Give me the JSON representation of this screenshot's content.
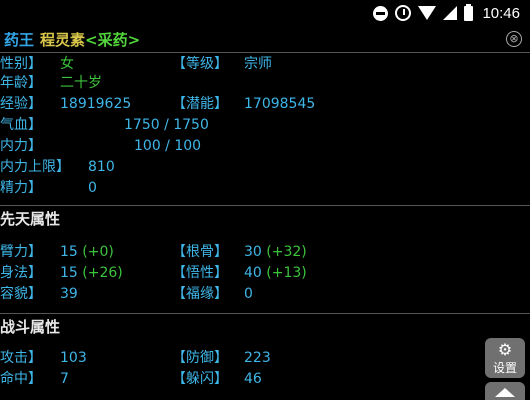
{
  "status_bar": {
    "time": "10:46",
    "icons": [
      "do-not-disturb-icon",
      "alarm-icon",
      "wifi-icon",
      "signal-icon",
      "battery-icon"
    ]
  },
  "title": {
    "rank": "药王",
    "name": "程灵素",
    "action": "<采药>",
    "close_icon": "⊗"
  },
  "basic": {
    "gender_label": "性别】",
    "gender_value": "女",
    "level_label": "【等级】",
    "level_value": "宗师",
    "age_label": "年龄】",
    "age_value": "二十岁",
    "exp_label": "经验】",
    "exp_value": "18919625",
    "potential_label": "【潜能】",
    "potential_value": "17098545",
    "hp_label": "气血】",
    "hp_value": "1750 / 1750",
    "mp_label": "内力】",
    "mp_value": "100 / 100",
    "mp_max_label": "内力上限】",
    "mp_max_value": "810",
    "spirit_label": "精力】",
    "spirit_value": "0"
  },
  "innate": {
    "title": "先天属性",
    "str_label": "臂力】",
    "str_value": "15",
    "str_bonus": "(+0)",
    "con_label": "【根骨】",
    "con_value": "30",
    "con_bonus": "(+32)",
    "dex_label": "身法】",
    "dex_value": "15",
    "dex_bonus": "(+26)",
    "int_label": "【悟性】",
    "int_value": "40",
    "int_bonus": "(+13)",
    "looks_label": "容貌】",
    "looks_value": "39",
    "luck_label": "【福缘】",
    "luck_value": "0"
  },
  "combat": {
    "title": "战斗属性",
    "atk_label": "攻击】",
    "atk_value": "103",
    "def_label": "【防御】",
    "def_value": "223",
    "hit_label": "命中】",
    "hit_value": "7",
    "dodge_label": "【躲闪】",
    "dodge_value": "46"
  },
  "fab": {
    "settings_label": "设置"
  }
}
